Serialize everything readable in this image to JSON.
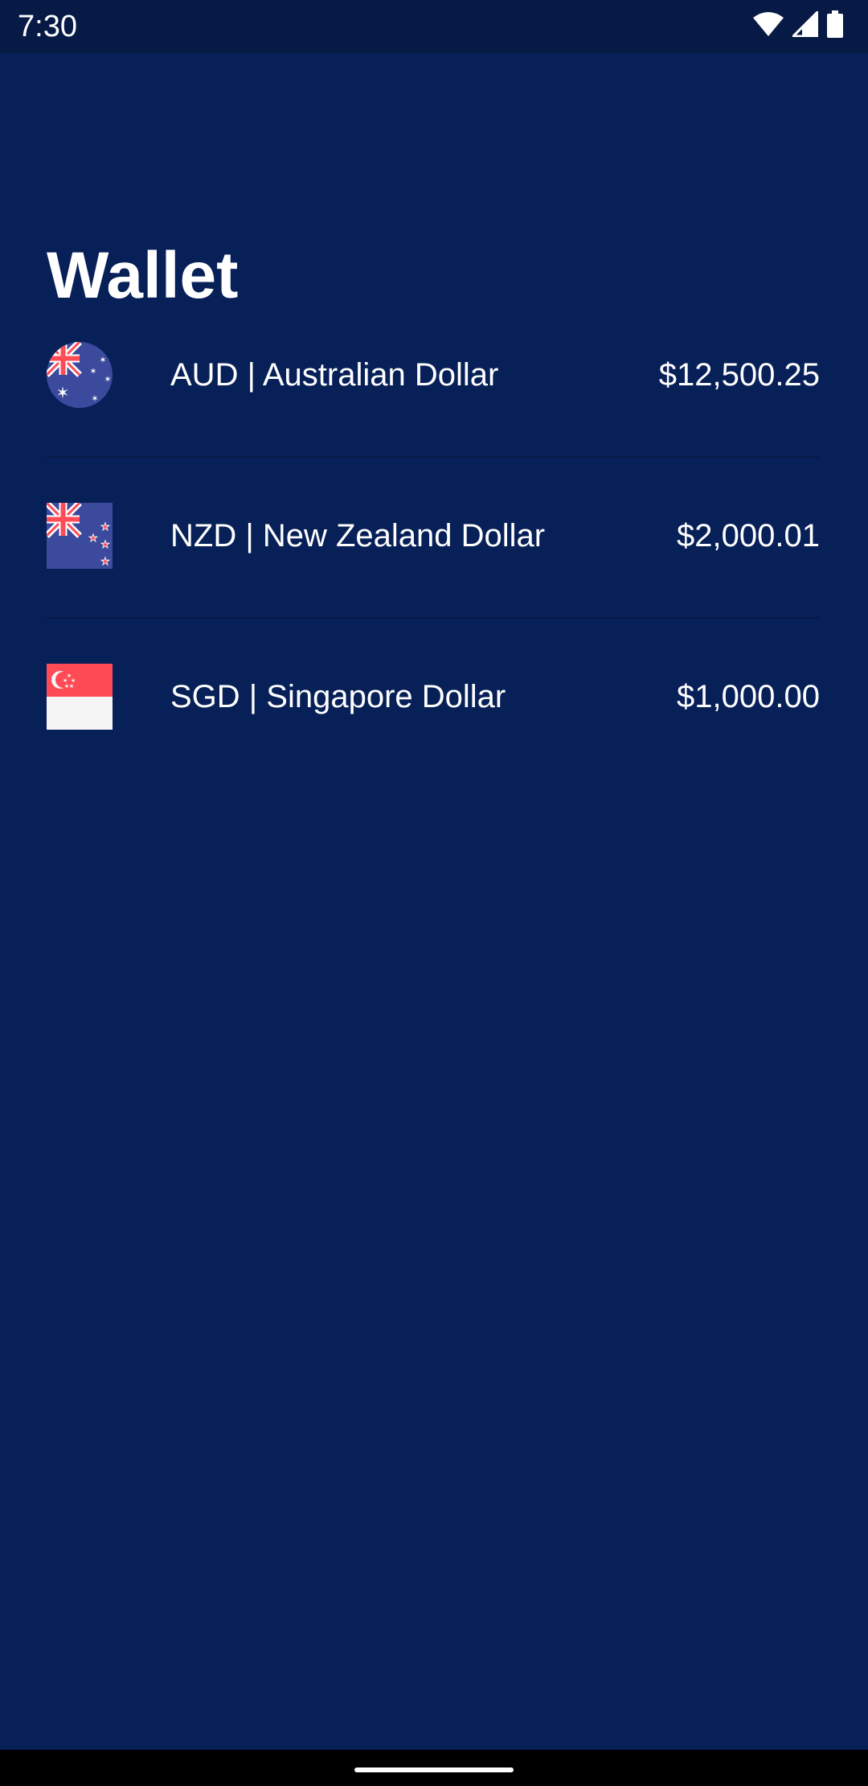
{
  "status_bar": {
    "time": "7:30",
    "icons": [
      "wifi-icon",
      "cellular-signal-icon",
      "battery-icon"
    ]
  },
  "page": {
    "title": "Wallet"
  },
  "wallets": [
    {
      "code_name": "AUD | Australian Dollar",
      "amount": "$12,500.25",
      "flag_icon": "australia-flag-icon"
    },
    {
      "code_name": "NZD | New Zealand Dollar",
      "amount": "$2,000.01",
      "flag_icon": "new-zealand-flag-icon"
    },
    {
      "code_name": "SGD | Singapore Dollar",
      "amount": "$1,000.00",
      "flag_icon": "singapore-flag-icon"
    }
  ],
  "colors": {
    "background": "#082058",
    "status_bar": "#061a45",
    "text": "#ffffff",
    "flag_blue": "#3b4a9c",
    "flag_red": "#ff4b55",
    "flag_white": "#f5f5f5"
  }
}
